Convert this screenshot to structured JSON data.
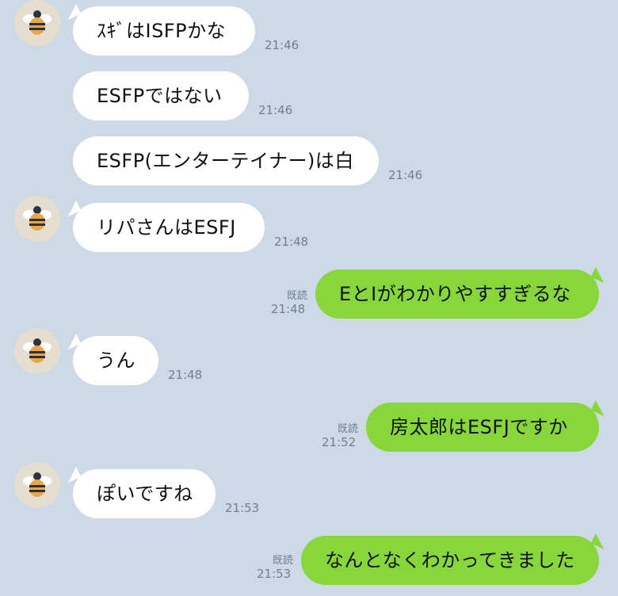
{
  "messages": [
    {
      "side": "in",
      "text": "ｽｷﾞはISFPかな",
      "time": "21:46",
      "avatar": true
    },
    {
      "side": "in",
      "text": "ESFPではない",
      "time": "21:46",
      "avatar": false
    },
    {
      "side": "in",
      "text": "ESFP(エンターテイナー)は白",
      "time": "21:46",
      "avatar": false
    },
    {
      "side": "in",
      "text": "リパさんはESFJ",
      "time": "21:48",
      "avatar": true
    },
    {
      "side": "out",
      "text": "EとIがわかりやすすぎるな",
      "time": "21:48",
      "read": "既読"
    },
    {
      "side": "in",
      "text": "うん",
      "time": "21:48",
      "avatar": true
    },
    {
      "side": "out",
      "text": "房太郎はESFJですか",
      "time": "21:52",
      "read": "既読"
    },
    {
      "side": "in",
      "text": "ぽいですね",
      "time": "21:53",
      "avatar": true
    },
    {
      "side": "out",
      "text": "なんとなくわかってきました",
      "time": "21:53",
      "read": "既読"
    }
  ],
  "colors": {
    "background": "#cdd9e4",
    "incoming_bubble": "#ffffff",
    "outgoing_bubble": "#86d63c",
    "timestamp": "#6f7f8e"
  },
  "icons": {
    "avatar": "bee-avatar-icon"
  }
}
